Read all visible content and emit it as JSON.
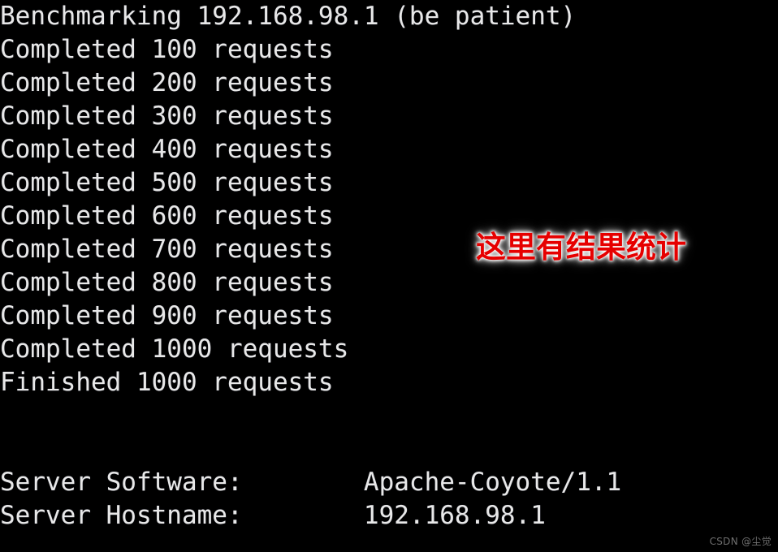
{
  "terminal": {
    "background_color": "#000000",
    "text_color": "#e8e8e8",
    "lines": [
      "Benchmarking 192.168.98.1 (be patient)",
      "Completed 100 requests",
      "Completed 200 requests",
      "Completed 300 requests",
      "Completed 400 requests",
      "Completed 500 requests",
      "Completed 600 requests",
      "Completed 700 requests",
      "Completed 800 requests",
      "Completed 900 requests",
      "Completed 1000 requests",
      "Finished 1000 requests",
      "",
      "",
      "Server Software:        Apache-Coyote/1.1",
      "Server Hostname:        192.168.98.1"
    ],
    "benchmark": {
      "header_command": "Benchmarking",
      "target_host": "192.168.98.1",
      "header_note": "(be patient)",
      "progress_label": "Completed",
      "finished_label": "Finished",
      "unit_label": "requests",
      "progress_counts": [
        100,
        200,
        300,
        400,
        500,
        600,
        700,
        800,
        900,
        1000
      ],
      "total_requests": 1000
    },
    "results": [
      {
        "key": "Server Software:",
        "value": "Apache-Coyote/1.1"
      },
      {
        "key": "Server Hostname:",
        "value": "192.168.98.1"
      }
    ]
  },
  "annotation": {
    "text": "这里有结果统计",
    "color": "#e60000",
    "glow_color": "#ffffff"
  },
  "watermark": {
    "text": "CSDN @尘觉",
    "color": "#6f6f6f"
  }
}
